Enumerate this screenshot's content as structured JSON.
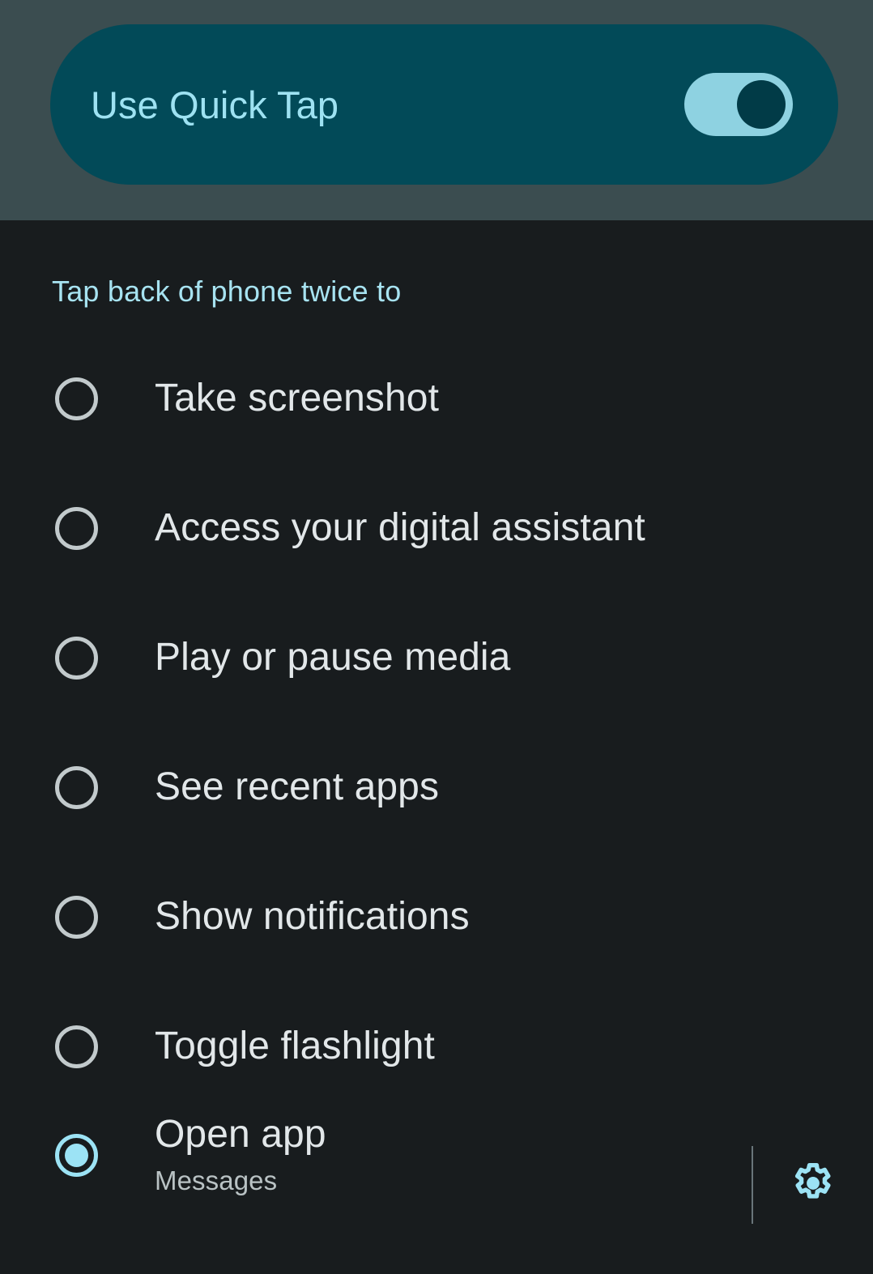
{
  "screen": {
    "background_color": "#181c1e",
    "header_background_color": "#3b4d50"
  },
  "master_switch": {
    "label": "Use Quick Tap",
    "state": "on",
    "card_color": "#024a58",
    "label_color": "#9ee2f2",
    "track_color": "#8ed2e1",
    "thumb_color": "#013b47"
  },
  "section": {
    "title": "Tap back of phone twice to",
    "title_color": "#a7e3f1"
  },
  "options": [
    {
      "label": "Take screenshot",
      "selected": false,
      "subtitle": null,
      "has_settings": false
    },
    {
      "label": "Access your digital assistant",
      "selected": false,
      "subtitle": null,
      "has_settings": false
    },
    {
      "label": "Play or pause media",
      "selected": false,
      "subtitle": null,
      "has_settings": false
    },
    {
      "label": "See recent apps",
      "selected": false,
      "subtitle": null,
      "has_settings": false
    },
    {
      "label": "Show notifications",
      "selected": false,
      "subtitle": null,
      "has_settings": false
    },
    {
      "label": "Toggle flashlight",
      "selected": false,
      "subtitle": null,
      "has_settings": false
    },
    {
      "label": "Open app",
      "selected": true,
      "subtitle": "Messages",
      "has_settings": true
    }
  ],
  "icons": {
    "settings": "gear-icon",
    "settings_color": "#9ce3f5"
  },
  "colors": {
    "radio_unselected": "#c2cacc",
    "radio_selected": "#9ce3f5",
    "option_label": "#e2e7e9",
    "option_subtitle": "#b9c2c4",
    "divider": "#69757a"
  }
}
